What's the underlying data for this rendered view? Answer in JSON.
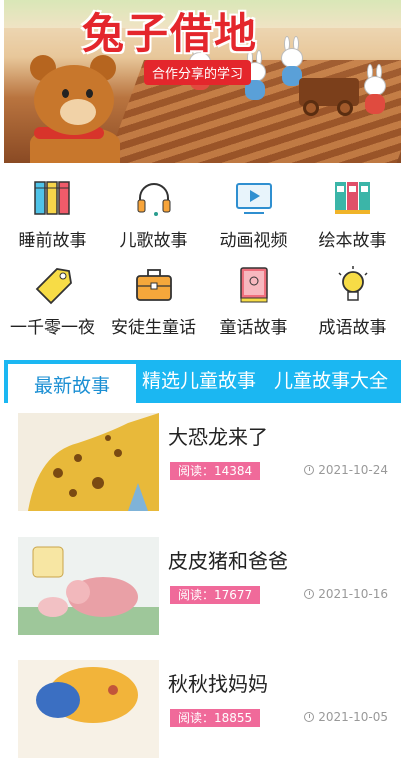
{
  "banner": {
    "title": "兔子借地",
    "subtitle": "合作分享的学习"
  },
  "categories": [
    {
      "label": "睡前故事",
      "icon": "books-icon"
    },
    {
      "label": "儿歌故事",
      "icon": "headphones-icon"
    },
    {
      "label": "动画视频",
      "icon": "video-play-icon"
    },
    {
      "label": "绘本故事",
      "icon": "picture-book-icon"
    },
    {
      "label": "一千零一夜",
      "icon": "tag-icon"
    },
    {
      "label": "安徒生童话",
      "icon": "briefcase-icon"
    },
    {
      "label": "童话故事",
      "icon": "book-icon"
    },
    {
      "label": "成语故事",
      "icon": "lightbulb-icon"
    }
  ],
  "tabs": [
    {
      "label": "最新故事"
    },
    {
      "label": "精选儿童故事"
    },
    {
      "label": "儿童故事大全"
    }
  ],
  "stories": [
    {
      "title": "大恐龙来了",
      "reads": "阅读：14384",
      "date": "2021-10-24"
    },
    {
      "title": "皮皮猪和爸爸",
      "reads": "阅读：17677",
      "date": "2021-10-16"
    },
    {
      "title": "秋秋找妈妈",
      "reads": "阅读：18855",
      "date": "2021-10-05"
    }
  ],
  "colors": {
    "tab_bar": "#1bb7f2",
    "active_tab_text": "#1b8fd3",
    "reads_badge": "#f06a9a",
    "banner_title": "#e4262c"
  }
}
